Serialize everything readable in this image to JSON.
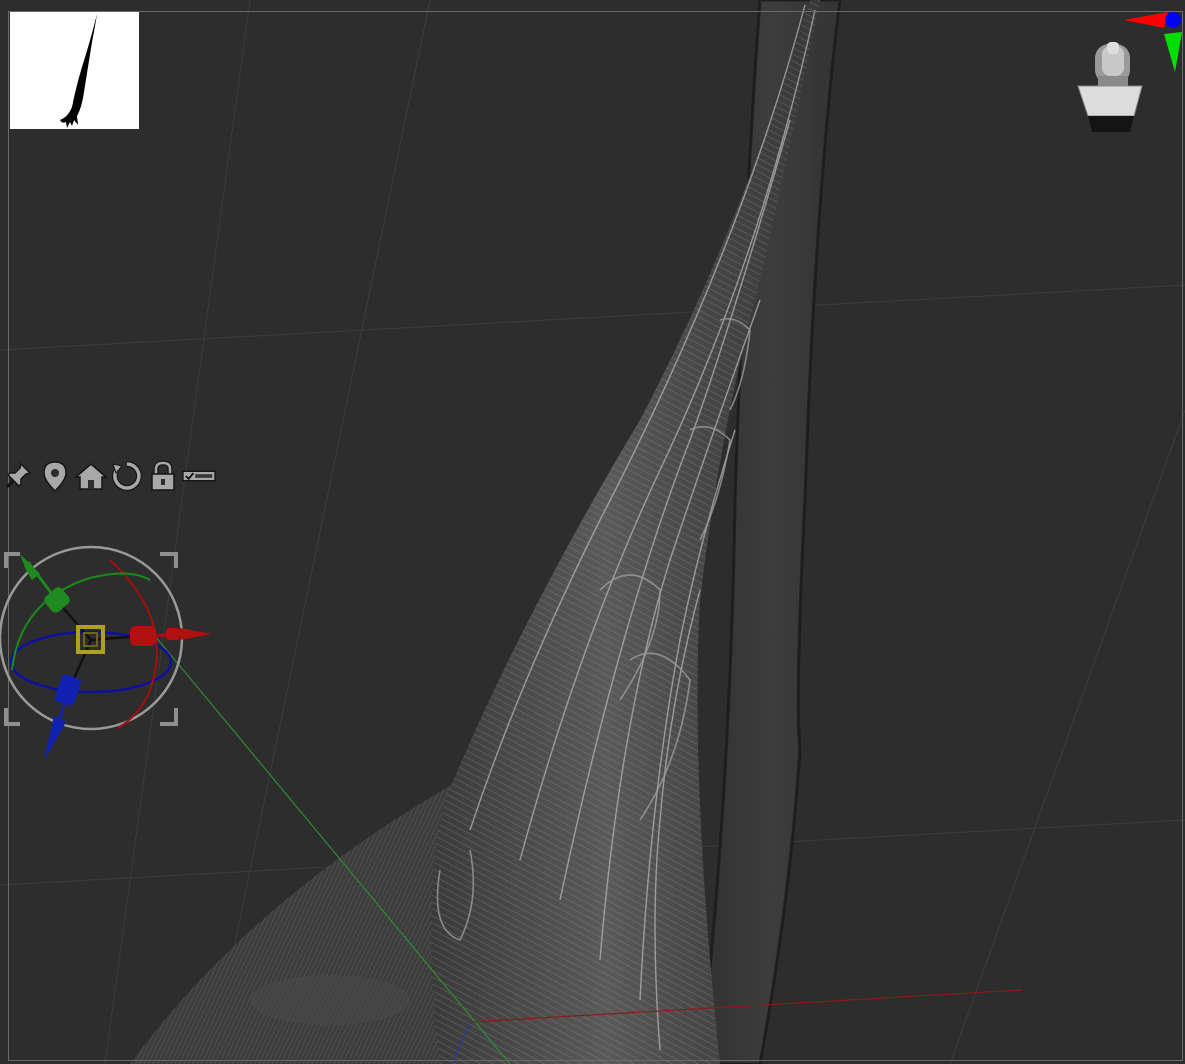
{
  "window": {
    "title": "",
    "background": "#2d2d2d",
    "frame_color": "#6a6a6a"
  },
  "thumbnail": {
    "icon": "feather-silhouette-icon",
    "background": "#ffffff"
  },
  "toolbar": {
    "tools": [
      {
        "name": "pin-icon"
      },
      {
        "name": "location-marker-icon"
      },
      {
        "name": "home-icon"
      },
      {
        "name": "reset-icon"
      },
      {
        "name": "lock-icon"
      },
      {
        "name": "checkbox-toggle-icon"
      }
    ]
  },
  "gizmo": {
    "x_color": "#b01010",
    "y_color": "#1f8a1f",
    "z_color": "#1020b0",
    "center_color": "#b0a020"
  },
  "navigator": {
    "icon": "head-navigator-icon",
    "axis_colors": {
      "x": "#ff0000",
      "y": "#00dd00",
      "z": "#0000ff"
    }
  }
}
